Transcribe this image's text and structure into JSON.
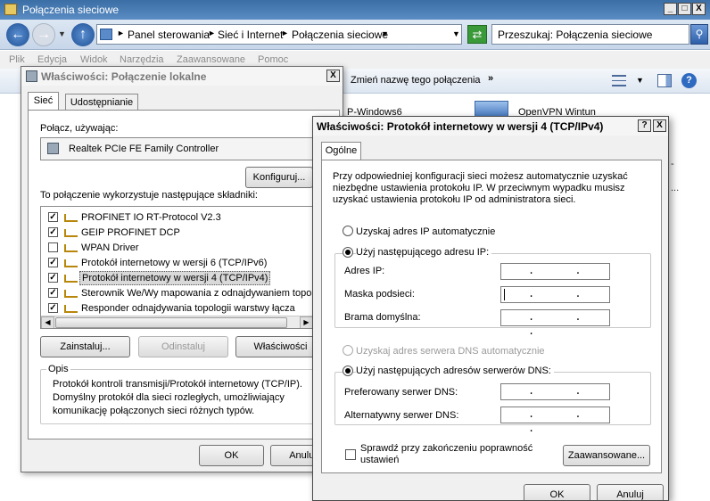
{
  "explorer": {
    "title": "Połączenia sieciowe",
    "address": [
      "Panel sterowania",
      "Sieć i Internet",
      "Połączenia sieciowe"
    ],
    "search_placeholder": "Przeszukaj: Połączenia sieciowe",
    "menu": [
      "Plik",
      "Edycja",
      "Widok",
      "Narzędzia",
      "Zaawansowane",
      "Pomoc"
    ],
    "toolbar_rename": "Zmień nazwę tego połączenia",
    "items": [
      {
        "label": "P-Windows6"
      },
      {
        "label": "OpenVPN Wintun"
      }
    ]
  },
  "dlg1": {
    "title": "Właściwości: Połączenie lokalne",
    "tabs": [
      "Sieć",
      "Udostępnianie"
    ],
    "connect_using_label": "Połącz, używając:",
    "adapter": "Realtek PCIe FE Family Controller",
    "configure_btn": "Konfiguruj...",
    "components_label": "To połączenie wykorzystuje następujące składniki:",
    "components": [
      {
        "label": "PROFINET IO RT-Protocol V2.3",
        "checked": true
      },
      {
        "label": "GEIP PROFINET DCP",
        "checked": true
      },
      {
        "label": "WPAN Driver",
        "checked": false
      },
      {
        "label": "Protokół internetowy w wersji 6 (TCP/IPv6)",
        "checked": true
      },
      {
        "label": "Protokół internetowy w wersji 4 (TCP/IPv4)",
        "checked": true
      },
      {
        "label": "Sterownik We/Wy mapowania z odnajdywaniem topologii",
        "checked": true
      },
      {
        "label": "Responder odnajdywania topologii warstwy łącza",
        "checked": true
      }
    ],
    "install_btn": "Zainstaluj...",
    "uninstall_btn": "Odinstaluj",
    "properties_btn": "Właściwości",
    "desc_title": "Opis",
    "desc_text": "Protokół kontroli transmisji/Protokół internetowy (TCP/IP). Domyślny protokół dla sieci rozległych, umożliwiający komunikację połączonych sieci różnych typów.",
    "ok_btn": "OK",
    "cancel_btn": "Anuluj"
  },
  "dlg2": {
    "title": "Właściwości: Protokół internetowy w wersji 4 (TCP/IPv4)",
    "help_btn": "?",
    "close_btn": "X",
    "tab": "Ogólne",
    "intro": "Przy odpowiedniej konfiguracji sieci możesz automatycznie uzyskać niezbędne ustawienia protokołu IP. W przeciwnym wypadku musisz uzyskać ustawienia protokołu IP od administratora sieci.",
    "auto_ip": "Uzyskaj adres IP automatycznie",
    "manual_ip": "Użyj następującego adresu IP:",
    "ip_label": "Adres IP:",
    "mask_label": "Maska podsieci:",
    "gateway_label": "Brama domyślna:",
    "auto_dns": "Uzyskaj adres serwera DNS automatycznie",
    "manual_dns": "Użyj następujących adresów serwerów DNS:",
    "pref_dns_label": "Preferowany serwer DNS:",
    "alt_dns_label": "Alternatywny serwer DNS:",
    "validate": "Sprawdź przy zakończeniu poprawność ustawień",
    "advanced_btn": "Zaawansowane...",
    "ok_btn": "OK",
    "cancel_btn": "Anuluj",
    "ip_value": ". . .",
    "mask_value": ". . .",
    "gateway_value": ". . .",
    "pref_dns_value": ". . .",
    "alt_dns_value": ". . ."
  }
}
